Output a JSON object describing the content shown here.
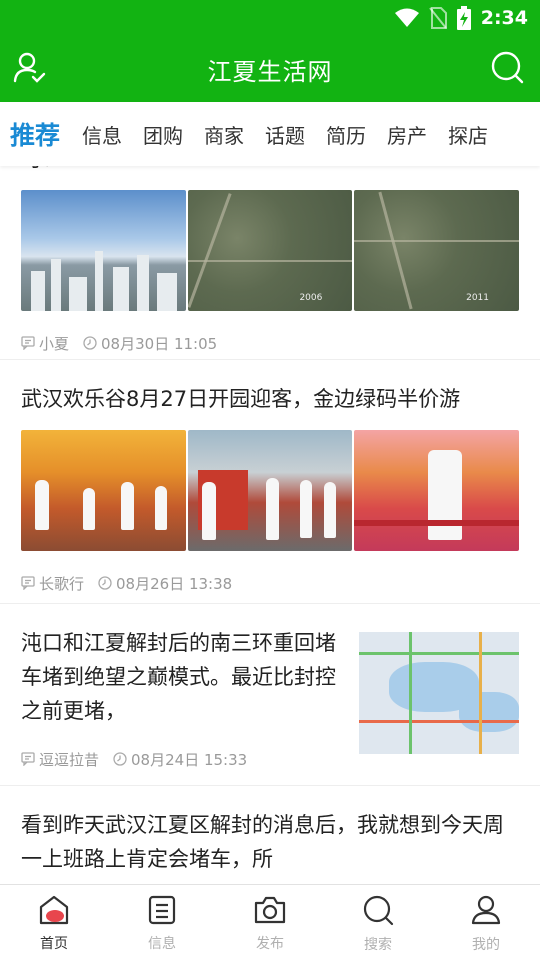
{
  "status_bar": {
    "time": "2:34"
  },
  "header": {
    "title": "江夏生活网",
    "user_icon": "user-icon",
    "search_icon": "search-icon"
  },
  "tabs": [
    "推荐",
    "信息",
    "团购",
    "商家",
    "话题",
    "简历",
    "房产",
    "探店"
  ],
  "feed": [
    {
      "title": "可：",
      "author": "小夏",
      "time": "08月30日 11:05"
    },
    {
      "title": "武汉欢乐谷8月27日开园迎客，金边绿码半价游",
      "author": "长歌行",
      "time": "08月26日 13:38"
    },
    {
      "title": "沌口和江夏解封后的南三环重回堵车堵到绝望之巅模式。最近比封控之前更堵，",
      "author": "逗逗拉昔",
      "time": "08月24日 15:33"
    },
    {
      "title": "看到昨天武汉江夏区解封的消息后，我就想到今天周一上班路上肯定会堵车，所"
    }
  ],
  "images": {
    "year_a": "2006",
    "year_b": "2011"
  },
  "bottom_nav": [
    {
      "label": "首页",
      "icon": "home-icon"
    },
    {
      "label": "信息",
      "icon": "document-icon"
    },
    {
      "label": "发布",
      "icon": "camera-icon"
    },
    {
      "label": "搜索",
      "icon": "search-icon"
    },
    {
      "label": "我的",
      "icon": "profile-icon"
    }
  ],
  "colors": {
    "brand_green": "#12b312",
    "tab_active": "#1a8ad4",
    "nav_active": "#e8464d"
  }
}
